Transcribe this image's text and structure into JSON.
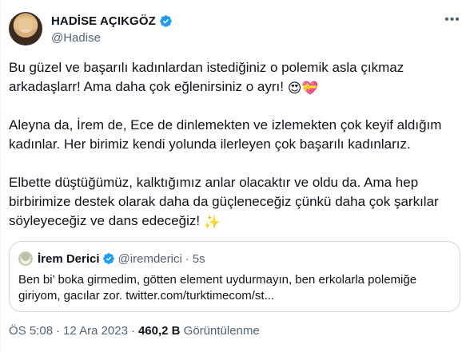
{
  "author": {
    "name": "HADİSE AÇIKGÖZ",
    "handle": "@Hadise",
    "verified_badge": "blue-check-icon"
  },
  "more_icon": "more-icon",
  "tweet": {
    "paragraphs": [
      {
        "text": "Bu güzel ve başarılı kadınlardan istediğiniz o polemik asla çıkmaz arkadaşlarr! Ama daha çok eğlenirsiniz o ayrı!",
        "emojis": [
          "😍",
          "💝"
        ]
      },
      {
        "text": "Aleyna da, İrem de, Ece de dinlemekten ve izlemekten çok keyif aldığım kadınlar. Her birimiz kendi yolunda ilerleyen çok başarılı kadınlarız.",
        "emojis": []
      },
      {
        "text": "Elbette düştüğümüz, kalktığımız anlar olacaktır ve oldu da. Ama hep birbirimize destek olarak daha da güçleneceğiz çünkü daha çok şarkılar söyleyeceğiz ve dans edeceğiz!",
        "emojis": [
          "✨"
        ]
      }
    ]
  },
  "quote": {
    "name": "İrem Derici",
    "handle": "@iremderici",
    "dot": "·",
    "time": "5s",
    "text": "Ben bi’ boka girmedim, götten element uydurmayın, ben erkolarla polemiğe giriyom, gacılar zor. twitter.com/turktimecom/st..."
  },
  "footer": {
    "time": "ÖS 5:08",
    "dot1": "·",
    "date": "12 Ara 2023",
    "dot2": "·",
    "views": "460,2 B",
    "views_label": "Görüntülenme"
  },
  "colors": {
    "verified": "#1d9bf0",
    "secondary_text": "#536471",
    "primary_text": "#0f1419",
    "border": "#cfd9de"
  }
}
